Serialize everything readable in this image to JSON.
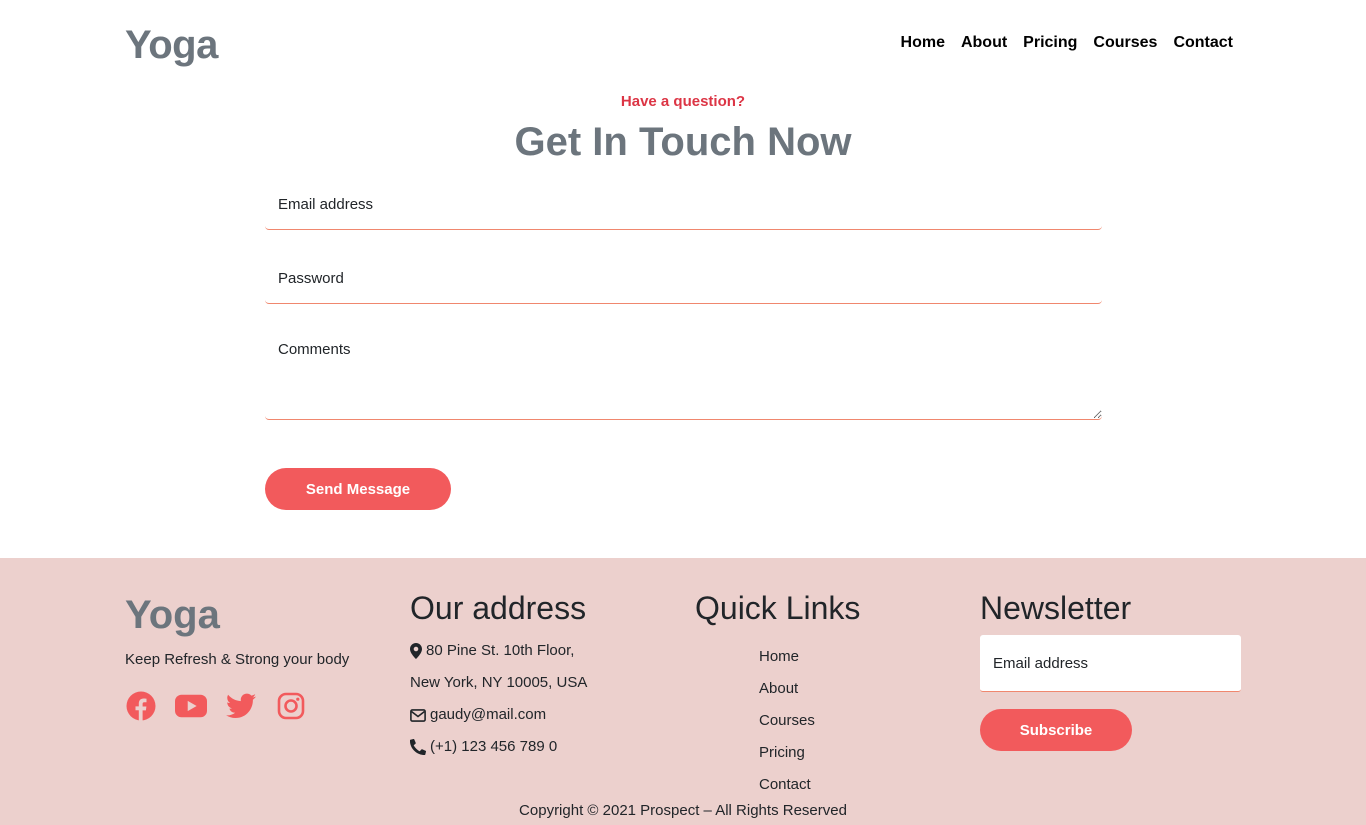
{
  "header": {
    "brand": "Yoga",
    "nav": [
      "Home",
      "About",
      "Pricing",
      "Courses",
      "Contact"
    ]
  },
  "contact": {
    "eyebrow": "Have a question?",
    "title": "Get In Touch Now",
    "email_placeholder": "Email address",
    "password_placeholder": "Password",
    "comments_placeholder": "Comments",
    "send_label": "Send Message"
  },
  "footer": {
    "brand": "Yoga",
    "tagline": "Keep Refresh & Strong your body",
    "socials": [
      "facebook-icon",
      "youtube-icon",
      "twitter-icon",
      "instagram-icon"
    ],
    "address": {
      "title": "Our address",
      "line1": "80 Pine St. 10th Floor,",
      "line2": "New York, NY 10005, USA",
      "email": "gaudy@mail.com",
      "phone": "(+1) 123 456 789 0"
    },
    "quick_links": {
      "title": "Quick Links",
      "items": [
        "Home",
        "About",
        "Courses",
        "Pricing",
        "Contact"
      ]
    },
    "newsletter": {
      "title": "Newsletter",
      "placeholder": "Email address",
      "subscribe_label": "Subscribe"
    },
    "copyright": "Copyright © 2021 Prospect – All Rights Reserved"
  },
  "colors": {
    "accent": "#f25a5c",
    "eyebrow": "#dc3545",
    "muted_heading": "#6c757d",
    "footer_bg": "#ecd0cd"
  }
}
